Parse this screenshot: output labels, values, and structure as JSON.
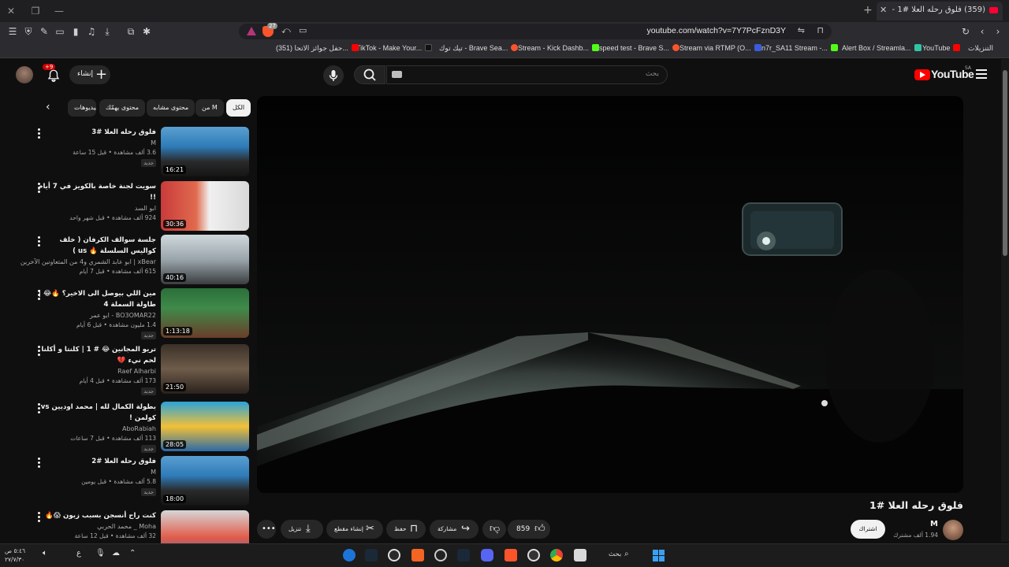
{
  "browser": {
    "tab_title": "(359) فلوق رحله العلا #1 - YouTube",
    "url": "youtube.com/watch?v=7Y7PcFznD3Y",
    "brave_badge": "27",
    "bookmarks": [
      {
        "label": "التنزيلات",
        "color": "#888888"
      },
      {
        "label": "YouTube",
        "color": "#ff0000"
      },
      {
        "label": "Alert Box / Streamla...",
        "color": "#31c3a2"
      },
      {
        "label": "n7r_SA11 Stream -...",
        "color": "#53fc18"
      },
      {
        "label": "Stream via RTMP (O...",
        "color": "#3b5bdb"
      },
      {
        "label": "speed test - Brave S...",
        "color": "#fb542b"
      },
      {
        "label": "Stream - Kick Dashb...",
        "color": "#53fc18"
      },
      {
        "label": "تيك توك - Brave Sea...",
        "color": "#fb542b"
      },
      {
        "label": "TikTok - Make Your...",
        "color": "#000000"
      },
      {
        "label": "(351) حفل جوائز الاتحا...",
        "color": "#ff0000"
      }
    ]
  },
  "youtube": {
    "logo": "YouTube",
    "region": "SA",
    "search_placeholder": "بحث",
    "create_label": "إنشاء",
    "notifications_badge": "+9"
  },
  "chips": [
    "الكل",
    "من M",
    "محتوى مشابه",
    "محتوى يهمّك",
    "فيديوهات"
  ],
  "recommendations": [
    {
      "title": "فلوق رحله العلا #3",
      "channel": "M",
      "meta": "3.6 ألف مشاهدة • قبل 15 ساعة",
      "badge": "جديد",
      "duration": "16:21",
      "thumb": "alula"
    },
    {
      "title": "سويت لجنة خاصة بالكويز في 7 أيام !!",
      "channel": "ابو السد",
      "meta": "924 ألف مشاهدة • قبل شهر واحد",
      "badge": "",
      "duration": "30:36",
      "thumb": "guy"
    },
    {
      "title": "جلسة سوالف الكرفان ( خلف كواليس السلسلة 🔥 us )",
      "channel": "xBear | ابو عابد الشمري و4 من المتعاونين الآخرين",
      "meta": "615 ألف مشاهدة • قبل 7 أيام",
      "badge": "",
      "duration": "40:16",
      "thumb": "caravan"
    },
    {
      "title": "مين اللي بيوصل الى الاخير؟ 🔥😂 | طاولة السملة 4",
      "channel": "BO3OMAR22 - ابو عمر",
      "meta": "1.4 مليون مشاهدة • قبل 6 أيام",
      "badge": "جديد",
      "duration": "1:13:18",
      "thumb": "table"
    },
    {
      "title": "تريو المجانين 😂 # 1 | كلنتا و أكلنا لحم نيء 💔",
      "channel": "Raef Alharbi",
      "meta": "173 ألف مشاهدة • قبل 4 أيام",
      "badge": "جديد",
      "duration": "21:50",
      "thumb": "car"
    },
    {
      "title": "بطولة الكمال لله | محمد اوديين vs كولمن !",
      "channel": "AboRabiah",
      "meta": "113 ألف مشاهدة • قبل 7 ساعات",
      "badge": "جديد",
      "duration": "28:05",
      "thumb": "tournament"
    },
    {
      "title": "فلوق رحله العلا #2",
      "channel": "M",
      "meta": "5.8 ألف مشاهدة • قبل يومين",
      "badge": "جديد",
      "duration": "18:00",
      "thumb": "alula"
    },
    {
      "title": "كنت راح أنسجن بسبب زبون 😱🔥",
      "channel": "Moha _ محمد الحربي",
      "meta": "32 ألف مشاهدة • قبل 12 ساعة",
      "badge": "",
      "duration": "",
      "thumb": "cars"
    }
  ],
  "video": {
    "title": "فلوق رحله العلا #1",
    "channel": "M",
    "subscribers": "1.94 ألف مشترك",
    "subscribe_label": "اشتراك",
    "likes": "859",
    "share_label": "مشاركة",
    "save_label": "حفظ",
    "clip_label": "إنشاء مقطع",
    "download_label": "تنزيل"
  },
  "taskbar": {
    "search_label": "بحث",
    "time": "٥:٤٦ ص",
    "date": "٢٧/٧/٣٠",
    "lang": "ع"
  },
  "colors": {
    "brand_red": "#ff0000",
    "bg": "#0f0f0f",
    "chip": "#272727"
  }
}
